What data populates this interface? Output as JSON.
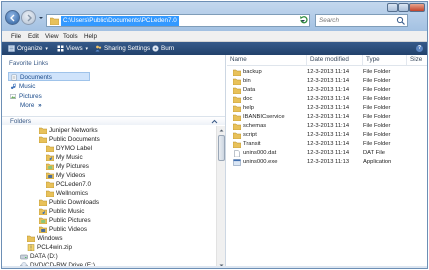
{
  "address": {
    "path": "C:\\Users\\Public\\Documents\\PCLeden7.0",
    "search_placeholder": "Search"
  },
  "menu": [
    "File",
    "Edit",
    "View",
    "Tools",
    "Help"
  ],
  "toolbar": {
    "organize": "Organize",
    "views": "Views",
    "sharing": "Sharing Settings",
    "burn": "Burn"
  },
  "nav": {
    "favorite_links_heading": "Favorite Links",
    "favorites": [
      {
        "label": "Documents",
        "icon": "documents-icon",
        "selected": true
      },
      {
        "label": "Music",
        "icon": "music-icon",
        "selected": false
      },
      {
        "label": "Pictures",
        "icon": "pictures-icon",
        "selected": false
      }
    ],
    "more_label": "More",
    "more_arrows": "»",
    "folders_heading": "Folders",
    "tree": [
      {
        "label": "Juniper Networks",
        "indent": 1,
        "icon": "folder-icon"
      },
      {
        "label": "Public Documents",
        "indent": 1,
        "icon": "folder-icon"
      },
      {
        "label": "DYMO Label",
        "indent": 2,
        "icon": "folder-icon"
      },
      {
        "label": "My Music",
        "indent": 2,
        "icon": "music-folder-icon"
      },
      {
        "label": "My Pictures",
        "indent": 2,
        "icon": "pictures-folder-icon"
      },
      {
        "label": "My Videos",
        "indent": 2,
        "icon": "videos-folder-icon"
      },
      {
        "label": "PCLeden7.0",
        "indent": 2,
        "icon": "folder-icon"
      },
      {
        "label": "Wellnomics",
        "indent": 2,
        "icon": "folder-icon"
      },
      {
        "label": "Public Downloads",
        "indent": 1,
        "icon": "folder-icon"
      },
      {
        "label": "Public Music",
        "indent": 1,
        "icon": "music-folder-icon"
      },
      {
        "label": "Public Pictures",
        "indent": 1,
        "icon": "pictures-folder-icon"
      },
      {
        "label": "Public Videos",
        "indent": 1,
        "icon": "videos-folder-icon"
      },
      {
        "label": "Windows",
        "indent": 0,
        "icon": "folder-icon"
      },
      {
        "label": "PCL4win.zip",
        "indent": 0,
        "icon": "zip-icon"
      },
      {
        "label": "DATA (D:)",
        "indent": -1,
        "icon": "drive-icon"
      },
      {
        "label": "DVD/CD-RW Drive (E:)",
        "indent": -1,
        "icon": "dvd-drive-icon"
      }
    ]
  },
  "files": {
    "columns": [
      "Name",
      "Date modified",
      "Type",
      "Size"
    ],
    "rows": [
      {
        "name": "backup",
        "date": "12-3-2013 11:14",
        "type": "File Folder",
        "icon": "folder-icon"
      },
      {
        "name": "bin",
        "date": "12-3-2013 11:14",
        "type": "File Folder",
        "icon": "folder-icon"
      },
      {
        "name": "Data",
        "date": "12-3-2013 11:14",
        "type": "File Folder",
        "icon": "folder-icon"
      },
      {
        "name": "doc",
        "date": "12-3-2013 11:14",
        "type": "File Folder",
        "icon": "folder-icon"
      },
      {
        "name": "help",
        "date": "12-3-2013 11:14",
        "type": "File Folder",
        "icon": "folder-icon"
      },
      {
        "name": "IBANBICservice",
        "date": "12-3-2013 11:14",
        "type": "File Folder",
        "icon": "folder-icon"
      },
      {
        "name": "schemas",
        "date": "12-3-2013 11:14",
        "type": "File Folder",
        "icon": "folder-icon"
      },
      {
        "name": "script",
        "date": "12-3-2013 11:14",
        "type": "File Folder",
        "icon": "folder-icon"
      },
      {
        "name": "Transit",
        "date": "12-3-2013 11:14",
        "type": "File Folder",
        "icon": "folder-icon"
      },
      {
        "name": "unins000.dat",
        "date": "12-3-2013 11:14",
        "type": "DAT File",
        "icon": "dat-file-icon"
      },
      {
        "name": "unins000.exe",
        "date": "12-3-2013 11:13",
        "type": "Application",
        "icon": "application-icon"
      }
    ]
  },
  "colors": {
    "toolbar": "#2c4d7a",
    "link": "#1a4a8a",
    "folder": "#e8c15a",
    "selection": "#3399ff"
  }
}
